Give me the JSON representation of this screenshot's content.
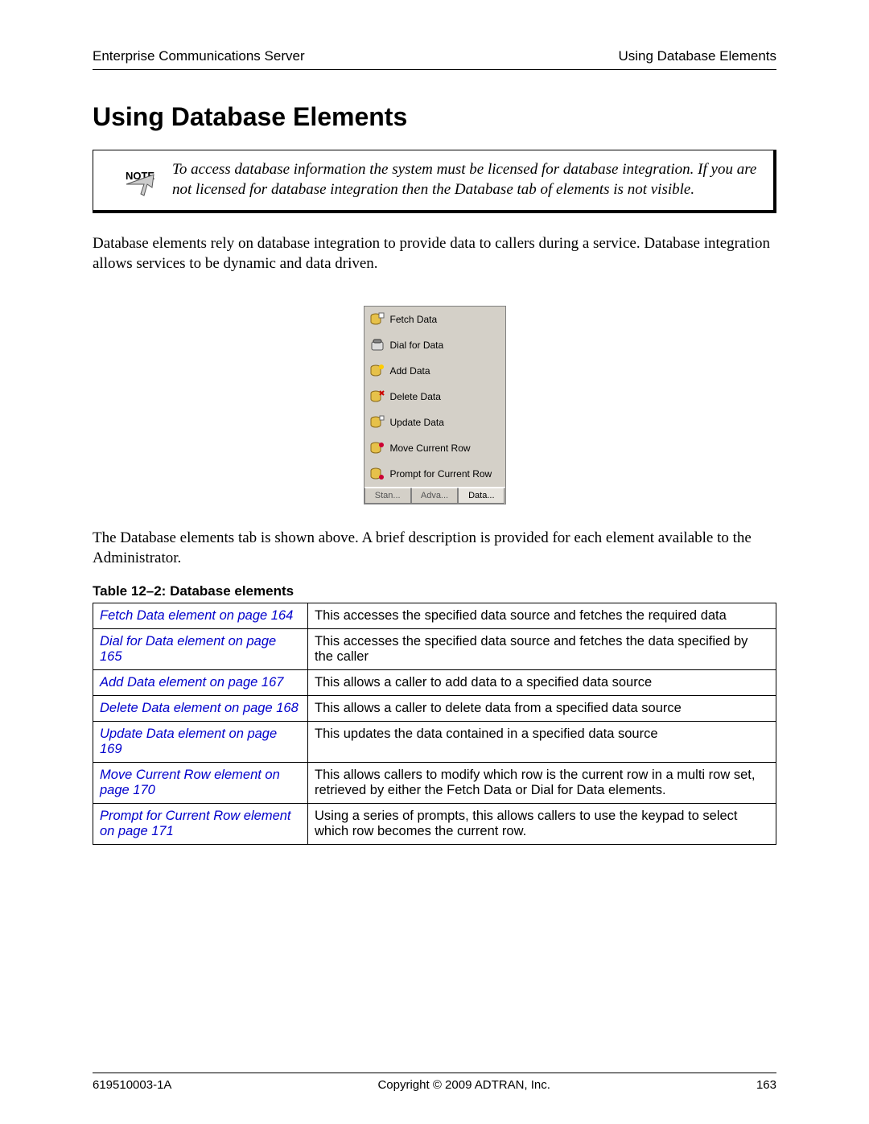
{
  "header": {
    "left": "Enterprise Communications Server",
    "right": "Using Database Elements"
  },
  "title": "Using Database Elements",
  "note": "To access database information the system must be licensed for database integration. If you are not licensed for database integration then the Database tab of elements is not visible.",
  "intro": "Database elements rely on database integration to provide data to callers during a service. Database integration allows services to be dynamic and data driven.",
  "panel": {
    "items": [
      "Fetch Data",
      "Dial for Data",
      "Add Data",
      "Delete Data",
      "Update Data",
      "Move Current Row",
      "Prompt for Current Row"
    ],
    "tabs": [
      "Stan...",
      "Adva...",
      "Data..."
    ]
  },
  "after_panel": "The Database elements tab is shown above. A brief description is provided for each element available to the Administrator.",
  "table_caption": "Table 12–2:  Database elements",
  "table": [
    {
      "link": "Fetch Data element on page 164",
      "desc": "This accesses the specified data source and fetches the required data"
    },
    {
      "link": "Dial for Data element on page 165",
      "desc": "This accesses the specified data source and fetches the data specified by the caller"
    },
    {
      "link": "Add Data element on page 167",
      "desc": "This allows a caller to add data to a specified data source"
    },
    {
      "link": "Delete Data element on page 168",
      "desc": "This allows a caller to delete data from a specified data source"
    },
    {
      "link": "Update Data element on page 169",
      "desc": "This updates the data contained in a specified data source"
    },
    {
      "link": "Move Current Row element on page 170",
      "desc": "This allows callers to modify which row is the current row in a multi row set, retrieved by either the Fetch Data or Dial for Data elements."
    },
    {
      "link": "Prompt for Current Row element on page 171",
      "desc": "Using a series of prompts, this allows callers to use the keypad to select which row becomes the current row."
    }
  ],
  "footer": {
    "left": "619510003-1A",
    "center": "Copyright © 2009 ADTRAN, Inc.",
    "right": "163"
  }
}
